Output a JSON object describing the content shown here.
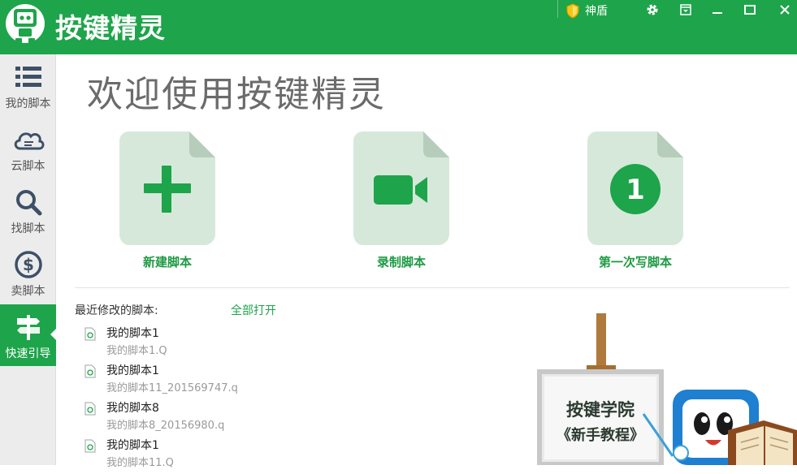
{
  "app": {
    "title": "按键精灵",
    "shield_label": "神盾"
  },
  "colors": {
    "brand_green": "#1ea44a",
    "doc_tile": "#d6e8da",
    "doc_fold": "#b6cdbb"
  },
  "window_controls": [
    "settings-icon",
    "dropdown-icon",
    "minimize-icon",
    "maximize-icon",
    "close-icon"
  ],
  "sidebar": {
    "items": [
      {
        "label": "我的脚本",
        "icon": "list-icon",
        "active": false
      },
      {
        "label": "云脚本",
        "icon": "cloud-icon",
        "active": false
      },
      {
        "label": "找脚本",
        "icon": "search-icon",
        "active": false
      },
      {
        "label": "卖脚本",
        "icon": "dollar-icon",
        "active": false
      },
      {
        "label": "快速引导",
        "icon": "signpost-icon",
        "active": true
      }
    ]
  },
  "main": {
    "welcome": "欢迎使用按键精灵",
    "actions": [
      {
        "label": "新建脚本",
        "icon": "plus-icon"
      },
      {
        "label": "录制脚本",
        "icon": "video-camera-icon"
      },
      {
        "label": "第一次写脚本",
        "icon": "number-one-icon",
        "glyph": "1"
      }
    ],
    "recent": {
      "title": "最近修改的脚本:",
      "open_all": "全部打开",
      "items": [
        {
          "name": "我的脚本1",
          "file": "我的脚本1.Q"
        },
        {
          "name": "我的脚本1",
          "file": "我的脚本11_201569747.q"
        },
        {
          "name": "我的脚本8",
          "file": "我的脚本8_20156980.q"
        },
        {
          "name": "我的脚本1",
          "file": "我的脚本11.Q"
        }
      ]
    },
    "academy": {
      "line1": "按键学院",
      "line2": "《新手教程》"
    }
  }
}
